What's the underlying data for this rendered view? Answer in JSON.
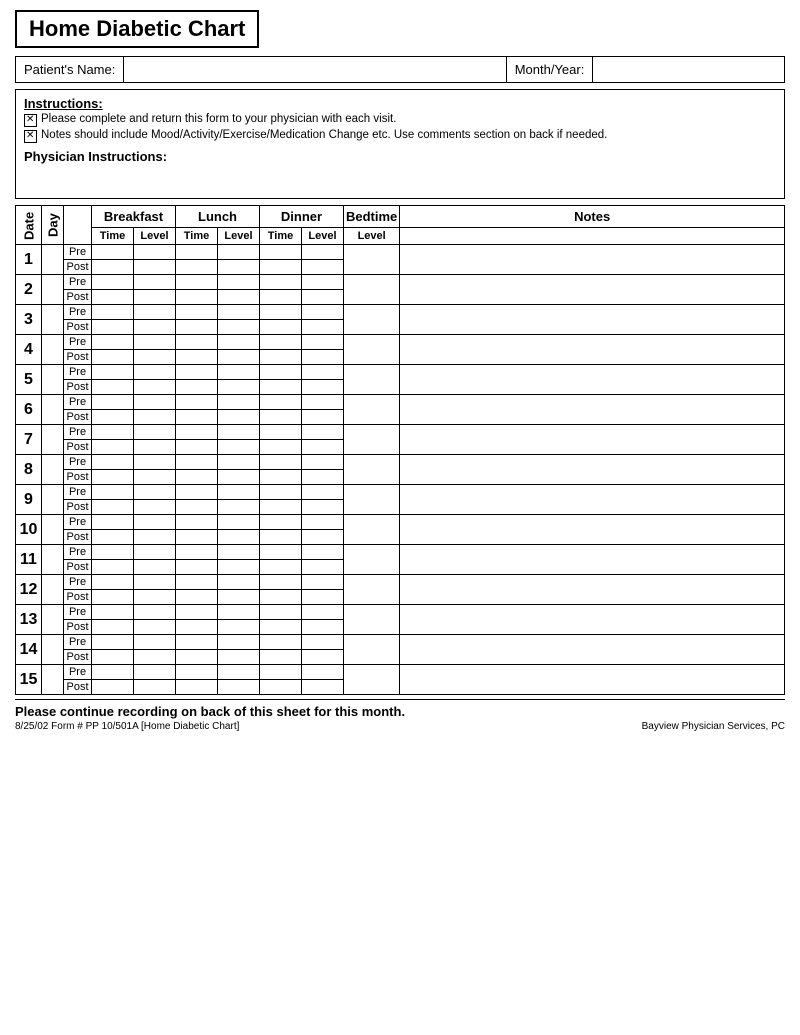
{
  "title": "Home Diabetic Chart",
  "patient_label": "Patient's Name:",
  "month_label": "Month/Year:",
  "instructions_title": "Instructions:",
  "instructions": [
    "Please complete and return this form to your physician with each visit.",
    "Notes should include Mood/Activity/Exercise/Medication Change etc.  Use comments section on back if needed."
  ],
  "physician_label": "Physician Instructions:",
  "table_headers": {
    "date": "Date",
    "day": "Day",
    "breakfast": "Breakfast",
    "lunch": "Lunch",
    "dinner": "Dinner",
    "bedtime": "Bedtime",
    "notes": "Notes",
    "time": "Time",
    "level": "Level"
  },
  "rows": [
    {
      "num": "1"
    },
    {
      "num": "2"
    },
    {
      "num": "3"
    },
    {
      "num": "4"
    },
    {
      "num": "5"
    },
    {
      "num": "6"
    },
    {
      "num": "7"
    },
    {
      "num": "8"
    },
    {
      "num": "9"
    },
    {
      "num": "10"
    },
    {
      "num": "11"
    },
    {
      "num": "12"
    },
    {
      "num": "13"
    },
    {
      "num": "14"
    },
    {
      "num": "15"
    }
  ],
  "pre_label": "Pre",
  "post_label": "Post",
  "footer_note": "Please continue recording on back of this sheet for this month.",
  "footer_small_left": "8/25/02  Form #  PP 10/501A   [Home Diabetic Chart]",
  "footer_small_right": "Bayview Physician Services, PC"
}
